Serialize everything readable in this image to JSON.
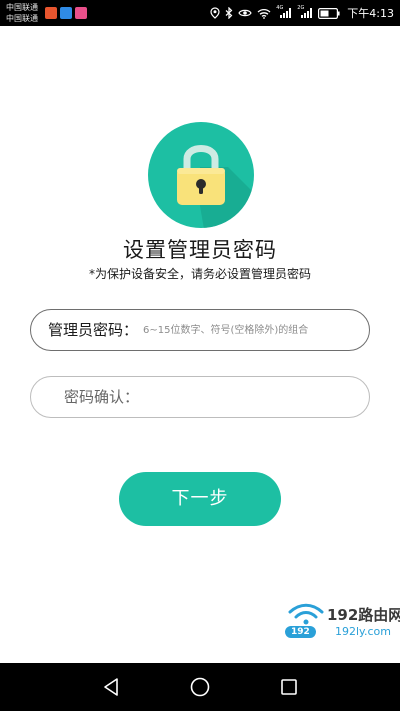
{
  "status_bar": {
    "carrier_1": "中国联通",
    "carrier_2": "中国联通",
    "notification_icons": [
      "weibo-icon",
      "maps-icon",
      "app-icon"
    ],
    "system_icons": [
      "location-icon",
      "bluetooth-icon",
      "eye-icon",
      "wifi-icon",
      "signal-4g-icon",
      "signal-2g-icon",
      "battery-icon"
    ],
    "signal_1_label": "4G",
    "signal_2_label": "2G",
    "time": "下午4:13"
  },
  "main": {
    "icon": "lock-icon",
    "title": "设置管理员密码",
    "subtitle": "*为保护设备安全，请务必设置管理员密码",
    "password_field": {
      "label": "管理员密码：",
      "placeholder": "6~15位数字、符号(空格除外)的组合",
      "value": ""
    },
    "confirm_field": {
      "label": "密码确认：",
      "value": ""
    },
    "next_button": "下一步"
  },
  "watermark": {
    "icon": "wifi-logo-icon",
    "title": "192路由网",
    "number": "192",
    "url": "192ly.com"
  },
  "nav_bar": {
    "items": [
      "back-icon",
      "home-icon",
      "recent-apps-icon"
    ]
  },
  "colors": {
    "accent": "#1dbfa3",
    "lock_circle": "#1dbfa3",
    "lock_body": "#f9e27a",
    "watermark_blue": "#2aa0d8"
  }
}
